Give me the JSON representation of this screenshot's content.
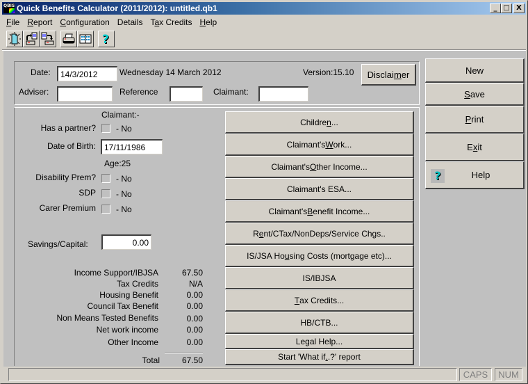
{
  "window": {
    "title": "Quick Benefits Calculator (2011/2012): untitled.qb1",
    "app_icon_text": "QBIS",
    "controls": {
      "minimize": "_",
      "maximize": "□",
      "close": "X"
    }
  },
  "menu": [
    {
      "label": "File",
      "accel": "F",
      "rest": "ile"
    },
    {
      "label": "Report",
      "accel": "R",
      "rest": "eport"
    },
    {
      "label": "Configuration",
      "accel": "C",
      "rest": "onfiguration"
    },
    {
      "label": "Details",
      "accel": "",
      "rest": "Details"
    },
    {
      "label": "Tax Credits",
      "pre": "T",
      "accel": "a",
      "rest": "x Credits"
    },
    {
      "label": "Help",
      "accel": "H",
      "rest": "elp"
    }
  ],
  "toolbar": [
    {
      "name": "new-document-icon"
    },
    {
      "name": "open-file-icon"
    },
    {
      "name": "save-file-icon"
    },
    {
      "name": "print-icon"
    },
    {
      "name": "calculator-icon"
    },
    {
      "name": "help-icon"
    }
  ],
  "header": {
    "date_label": "Date:",
    "date_value": "14/3/2012",
    "date_long": "Wednesday 14 March 2012",
    "version": "Version:15.10",
    "disclaimer_pre": "Disclai",
    "disclaimer_accel": "m",
    "disclaimer_post": "er",
    "adviser_label": "Adviser:",
    "adviser_value": "",
    "reference_label": "Reference",
    "reference_value": "",
    "claimant_label": "Claimant:",
    "claimant_value": ""
  },
  "claimant": {
    "heading": "Claimant:-",
    "has_partner_label": "Has a partner?",
    "has_partner_value": "- No",
    "dob_label": "Date of Birth:",
    "dob_value": "17/11/1986",
    "age": "Age:25",
    "disability_label": "Disability Prem?",
    "disability_value": "- No",
    "sdp_label": "SDP",
    "sdp_value": "- No",
    "carer_label": "Carer Premium",
    "carer_value": "- No",
    "savings_label": "Savings/Capital:",
    "savings_value": "0.00"
  },
  "results": [
    {
      "label": "Income Support/IBJSA",
      "value": "67.50"
    },
    {
      "label": "Tax Credits",
      "value": "N/A"
    },
    {
      "label": "Housing Benefit",
      "value": "0.00"
    },
    {
      "label": "Council Tax Benefit",
      "value": "0.00"
    },
    {
      "label": "Non Means Tested Benefits",
      "value": "0.00"
    },
    {
      "label": "Net work income",
      "value": "0.00"
    },
    {
      "label": "Other Income",
      "value": "0.00"
    }
  ],
  "total": {
    "label": "Total",
    "value": "67.50"
  },
  "detail_buttons": [
    {
      "pre": "Childre",
      "accel": "n",
      "post": "..."
    },
    {
      "pre": "Claimant's ",
      "accel": "W",
      "post": "ork..."
    },
    {
      "pre": "Claimant's ",
      "accel": "O",
      "post": "ther Income..."
    },
    {
      "pre": "Claimant's ESA...",
      "accel": "",
      "post": ""
    },
    {
      "pre": "Claimant's ",
      "accel": "B",
      "post": "enefit Income..."
    },
    {
      "pre": "R",
      "accel": "e",
      "post": "nt/CTax/NonDeps/Service Chgs.."
    },
    {
      "pre": "IS/JSA Ho",
      "accel": "u",
      "post": "sing Costs (mortgage etc)..."
    },
    {
      "pre": "IS/IBJSA",
      "accel": "",
      "post": ""
    },
    {
      "pre": "",
      "accel": "T",
      "post": "ax Credits..."
    },
    {
      "pre": "HB/CTB...",
      "accel": "",
      "post": ""
    },
    {
      "pre": "Legal Help...",
      "accel": "",
      "post": ""
    },
    {
      "pre": "Start 'What if",
      "accel": ".",
      "post": ".?' report"
    }
  ],
  "side_buttons": {
    "new": {
      "pre": "New",
      "accel": "",
      "post": ""
    },
    "save": {
      "pre": "",
      "accel": "S",
      "post": "ave"
    },
    "print": {
      "pre": "",
      "accel": "P",
      "post": "rint"
    },
    "exit": {
      "pre": "E",
      "accel": "x",
      "post": "it"
    },
    "help": {
      "pre": "Help",
      "accel": "",
      "post": "",
      "icon": "?"
    }
  },
  "statusbar": {
    "message": "",
    "caps": "CAPS",
    "num": "NUM"
  }
}
